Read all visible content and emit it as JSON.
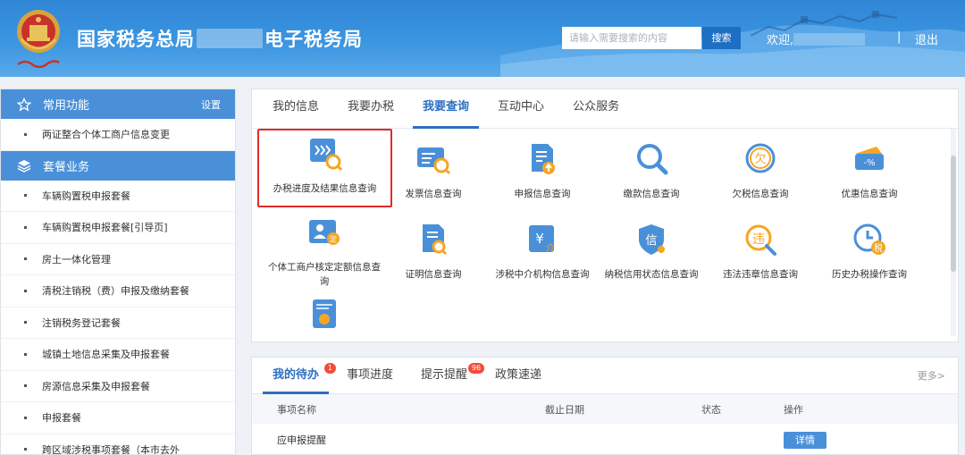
{
  "header": {
    "title_prefix": "国家税务总局",
    "title_suffix": "电子税务局",
    "emblem_caption": "中国税务",
    "search": {
      "placeholder": "请输入需要搜索的内容",
      "button_label": "搜索"
    },
    "welcome_label": "欢迎,",
    "divider": "|",
    "logout_label": "退出"
  },
  "sidebar": {
    "common": {
      "title": "常用功能",
      "settings_label": "设置",
      "icon": "star-icon"
    },
    "common_items": [
      {
        "label": "两证整合个体工商户信息变更"
      }
    ],
    "package": {
      "title": "套餐业务",
      "icon": "layers-icon"
    },
    "package_items": [
      {
        "label": "车辆购置税申报套餐"
      },
      {
        "label": "车辆购置税申报套餐[引导页]"
      },
      {
        "label": "房土一体化管理"
      },
      {
        "label": "清税注销税（费）申报及缴纳套餐"
      },
      {
        "label": "注销税务登记套餐"
      },
      {
        "label": "城镇土地信息采集及申报套餐"
      },
      {
        "label": "房源信息采集及申报套餐"
      },
      {
        "label": "申报套餐"
      },
      {
        "label": "跨区域涉税事项套餐（本市去外"
      }
    ]
  },
  "services": {
    "tabs": [
      {
        "label": "我的信息",
        "active": false
      },
      {
        "label": "我要办税",
        "active": false
      },
      {
        "label": "我要查询",
        "active": true
      },
      {
        "label": "互动中心",
        "active": false
      },
      {
        "label": "公众服务",
        "active": false
      }
    ],
    "items": [
      {
        "label": "办税进度及结果信息查询",
        "icon": "progress-search-icon",
        "highlighted": true
      },
      {
        "label": "发票信息查询",
        "icon": "invoice-search-icon"
      },
      {
        "label": "申报信息查询",
        "icon": "declaration-upload-icon"
      },
      {
        "label": "缴款信息查询",
        "icon": "magnifier-icon"
      },
      {
        "label": "欠税信息查询",
        "icon": "tax-arrears-icon"
      },
      {
        "label": "优惠信息查询",
        "icon": "discount-ticket-icon"
      },
      {
        "label": "个体工商户核定定额信息查询",
        "icon": "business-owner-icon"
      },
      {
        "label": "证明信息查询",
        "icon": "certificate-search-icon"
      },
      {
        "label": "涉税中介机构信息查询",
        "icon": "tax-agency-icon"
      },
      {
        "label": "纳税信用状态信息查询",
        "icon": "credit-shield-icon"
      },
      {
        "label": "违法违章信息查询",
        "icon": "violation-search-icon"
      },
      {
        "label": "历史办税操作查询",
        "icon": "history-clock-icon"
      },
      {
        "label": "",
        "icon": "statistics-report-icon"
      }
    ],
    "colors": {
      "accent": "#2c6fc1",
      "highlight_border": "#e02b2b"
    }
  },
  "todo": {
    "tabs": [
      {
        "label": "我的待办",
        "badge": "1",
        "active": true
      },
      {
        "label": "事项进度",
        "badge": "",
        "active": false
      },
      {
        "label": "提示提醒",
        "badge": "96",
        "active": false
      },
      {
        "label": "政策速递",
        "badge": "",
        "active": false
      }
    ],
    "more_label": "更多>",
    "columns": [
      "事项名称",
      "截止日期",
      "状态",
      "操作"
    ],
    "rows": [
      {
        "name": "应申报提醒",
        "deadline": "",
        "status": "",
        "action": "详情"
      }
    ]
  }
}
